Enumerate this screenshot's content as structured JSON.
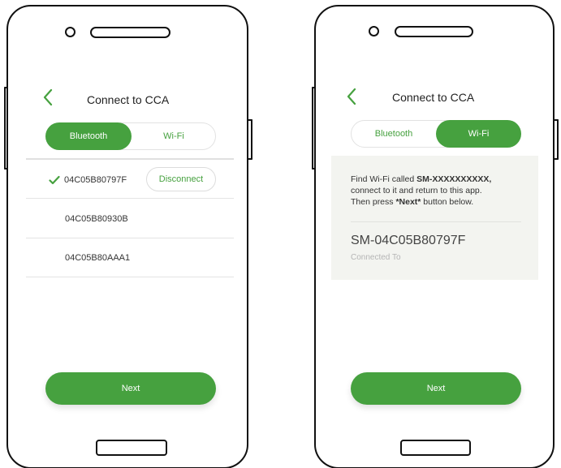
{
  "left_screen": {
    "title": "Connect to CCA",
    "tabs": [
      {
        "label": "Bluetooth",
        "active": true
      },
      {
        "label": "Wi-Fi",
        "active": false
      }
    ],
    "devices": [
      {
        "name": "04C05B80797F",
        "connected": true,
        "action_label": "Disconnect"
      },
      {
        "name": "04C05B80930B",
        "connected": false
      },
      {
        "name": "04C05B80AAA1",
        "connected": false
      }
    ],
    "next_label": "Next"
  },
  "right_screen": {
    "title": "Connect to CCA",
    "tabs": [
      {
        "label": "Bluetooth",
        "active": false
      },
      {
        "label": "Wi-Fi",
        "active": true
      }
    ],
    "instructions": {
      "line1_prefix": "Find Wi-Fi called ",
      "line1_bold": "SM-XXXXXXXXXX,",
      "line2": "connect to it and return to this app.",
      "line3_prefix": "Then press ",
      "line3_bold": "*Next*",
      "line3_suffix": " button below."
    },
    "ssid": "SM-04C05B80797F",
    "ssid_status": "Connected To",
    "next_label": "Next"
  },
  "colors": {
    "accent": "#46a13f",
    "panel_bg": "#f3f4f0"
  },
  "icons": {
    "back": "chevron-left-icon",
    "check": "checkmark-icon"
  }
}
